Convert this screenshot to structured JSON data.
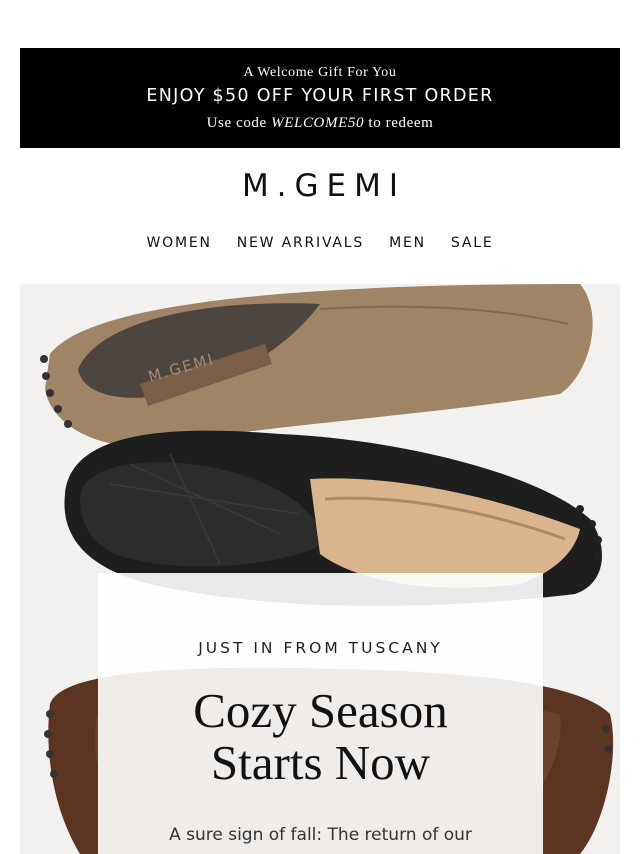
{
  "banner": {
    "kicker": "A Welcome Gift For You",
    "headline": "ENJOY $50 OFF YOUR FIRST ORDER",
    "subline_prefix": "Use code",
    "code": "WELCOME50",
    "subline_suffix": "to redeem"
  },
  "brand": {
    "logo": "M.GEMI"
  },
  "nav": {
    "items": [
      {
        "label": "WOMEN"
      },
      {
        "label": "NEW ARRIVALS"
      },
      {
        "label": "MEN"
      },
      {
        "label": "SALE"
      }
    ]
  },
  "hero": {
    "image": "shearling-driving-moccasins-photo",
    "shoe_brand_stamp": "M.GEMI",
    "shoes": [
      "tan-suede-moccasin",
      "black-croc-moccasin",
      "brown-suede-moccasin"
    ]
  },
  "card": {
    "eyebrow": "JUST IN FROM TUSCANY",
    "title_line1": "Cozy Season",
    "title_line2": "Starts Now",
    "body": "A sure sign of fall: The return of our"
  },
  "colors": {
    "banner_bg": "#000000",
    "text": "#111111",
    "hero_bg": "#f2f1ef"
  }
}
